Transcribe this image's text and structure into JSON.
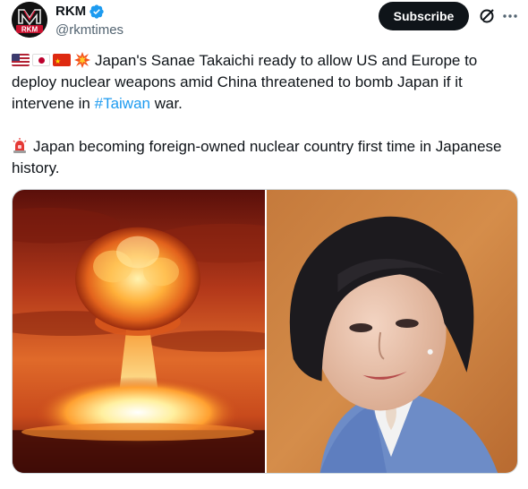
{
  "author": {
    "display_name": "RKM",
    "handle": "@rkmtimes",
    "avatar_text": "RKM",
    "verified": true
  },
  "actions": {
    "subscribe_label": "Subscribe",
    "grok_icon": "grok-icon",
    "more_icon": "more-icon"
  },
  "tweet": {
    "paragraph1_prefix": "Japan's Sanae Takaichi ready to allow US and Europe to deploy nuclear weapons amid China threatened to bomb Japan if it intervene in ",
    "hashtag": "#Taiwan",
    "paragraph1_suffix": " war.",
    "paragraph1_emojis": [
      "us-flag",
      "japan-flag",
      "china-flag",
      "collision"
    ],
    "paragraph2": "Japan becoming foreign-owned nuclear country first time in Japanese history.",
    "paragraph2_emoji": "police-siren"
  },
  "media": {
    "images": [
      "nuclear-explosion-photo",
      "sanae-takaichi-photo"
    ]
  },
  "colors": {
    "link": "#1d9bf0",
    "text": "#0f1419",
    "secondary": "#536471",
    "verified": "#1d9bf0"
  }
}
